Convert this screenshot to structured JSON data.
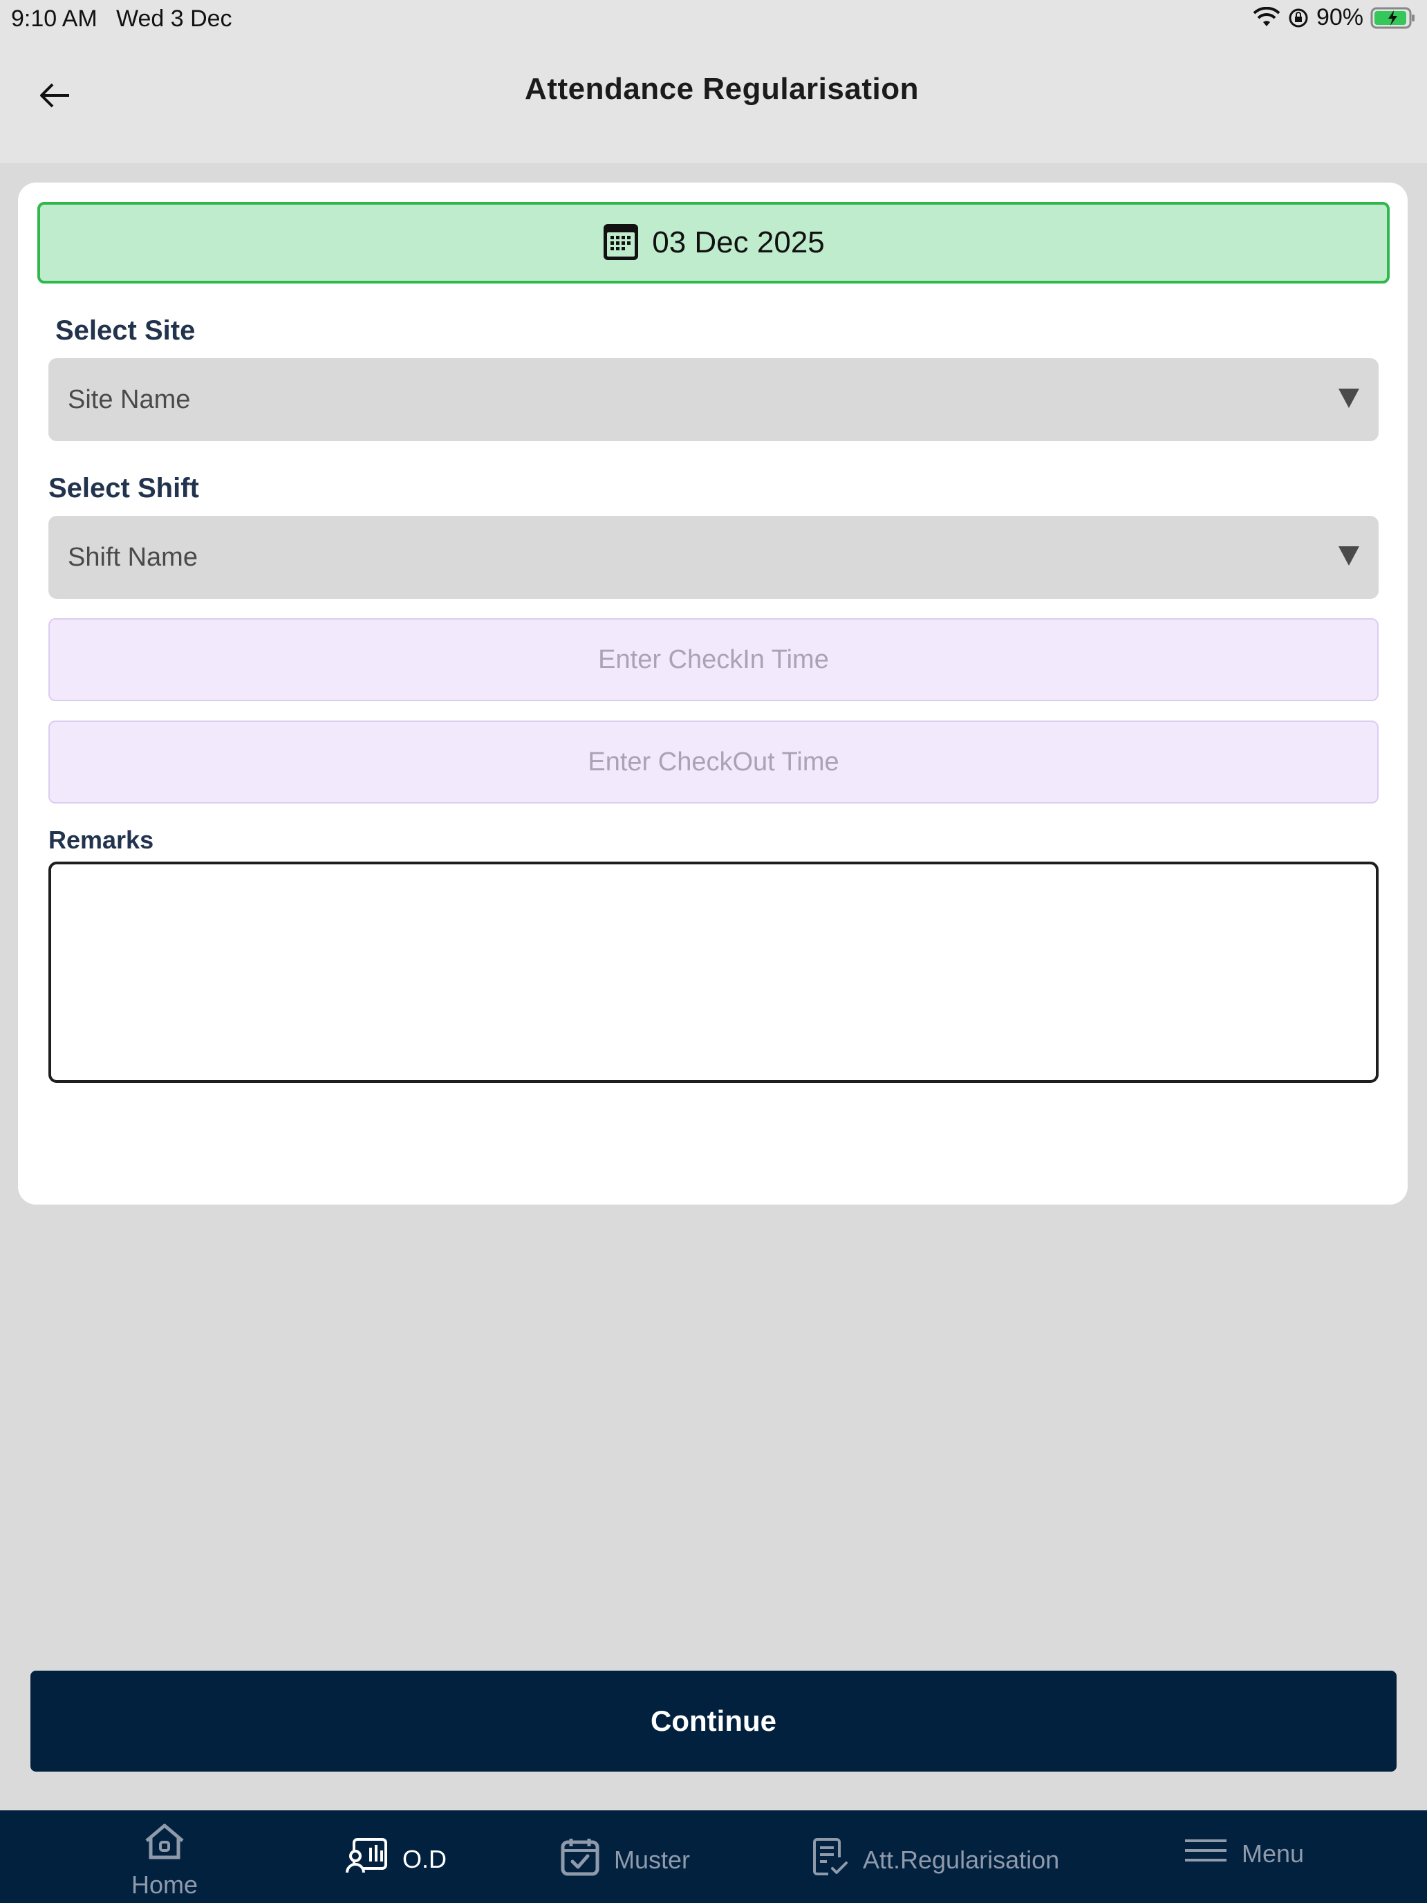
{
  "status_bar": {
    "time": "9:10 AM",
    "date": "Wed 3 Dec",
    "battery": "90%"
  },
  "header": {
    "title": "Attendance Regularisation",
    "back_icon": "arrow-left-icon"
  },
  "form": {
    "date": "03 Dec 2025",
    "site_label": "Select Site",
    "site_value": "Site Name",
    "shift_label": "Select Shift",
    "shift_value": "Shift Name",
    "checkin_placeholder": "Enter CheckIn Time",
    "checkout_placeholder": "Enter CheckOut Time",
    "remarks_label": "Remarks",
    "remarks_value": ""
  },
  "continue_label": "Continue",
  "tabs": [
    {
      "label": "Home",
      "icon": "home-icon"
    },
    {
      "label": "O.D",
      "icon": "od-icon",
      "active": true
    },
    {
      "label": "Muster",
      "icon": "calendar-check-icon"
    },
    {
      "label": "Att.Regularisation",
      "icon": "document-check-icon"
    },
    {
      "label": "Menu",
      "icon": "menu-icon"
    }
  ],
  "colors": {
    "date_bar_bg": "#c0ecce",
    "date_bar_border": "#2fb84c",
    "navy": "#02213f",
    "time_input_bg": "#f3e9fd"
  }
}
